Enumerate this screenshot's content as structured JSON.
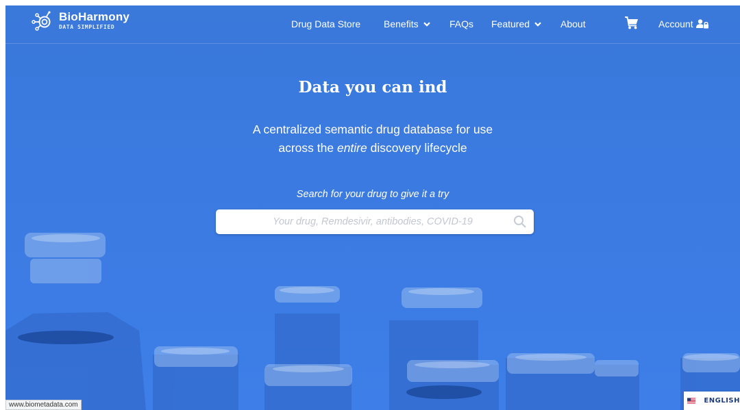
{
  "brand": {
    "name": "BioHarmony",
    "tagline": "DATA SIMPLIFIED"
  },
  "nav": {
    "drug_data_store": "Drug Data Store",
    "benefits": "Benefits",
    "faqs": "FAQs",
    "featured": "Featured",
    "about": "About",
    "account": "Account"
  },
  "hero": {
    "title": "Data you can ind",
    "subtitle_line1": "A centralized semantic drug database for use",
    "subtitle_line2_pre": "across the ",
    "subtitle_line2_em": "entire",
    "subtitle_line2_post": " discovery lifecycle",
    "search_label": "Search for your drug to give it a try",
    "search_placeholder": "Your drug, Remdesivir, antibodies, COVID-19"
  },
  "status_bar": {
    "url": "www.biometadata.com"
  },
  "language": {
    "label": "ENGLISH"
  },
  "icons": {
    "logo": "bioharmony-logo-icon",
    "chevron": "chevron-down-icon",
    "cart": "cart-icon",
    "account": "account-user-lock-icon",
    "search": "search-icon",
    "flag": "us-flag-icon"
  },
  "colors": {
    "hero_blue": "#3b7ae0",
    "text": "#ffffff",
    "placeholder": "#c3c7cf",
    "language_text": "#1d3b78"
  }
}
